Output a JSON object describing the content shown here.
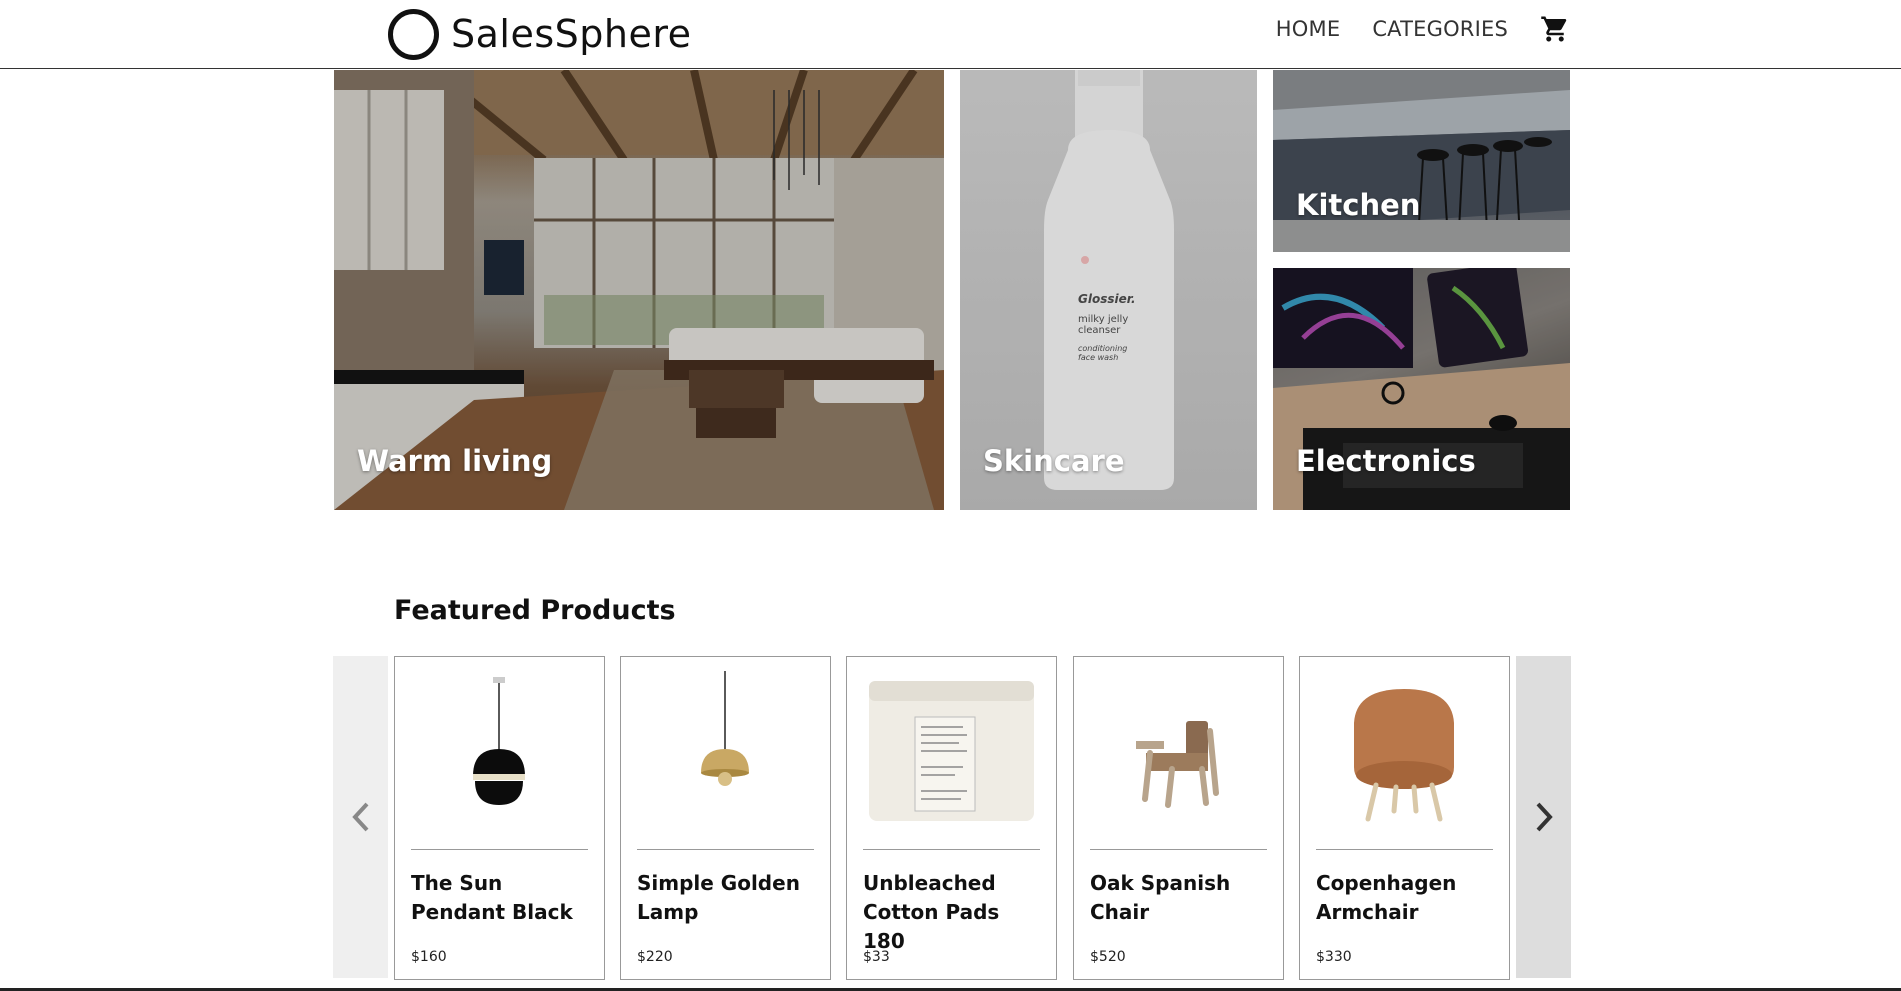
{
  "brand": {
    "name": "SalesSphere"
  },
  "nav": {
    "home": "HOME",
    "categories": "CATEGORIES",
    "cart_icon": "cart-icon"
  },
  "hero": {
    "tiles": [
      {
        "label": "Warm living"
      },
      {
        "label": "Skincare"
      },
      {
        "label": "Kitchen"
      },
      {
        "label": "Electronics"
      }
    ],
    "skincare_bottle": {
      "brand": "Glossier.",
      "line1": "milky jelly",
      "line2": "cleanser",
      "line3": "conditioning",
      "line4": "face wash"
    }
  },
  "featured": {
    "title": "Featured Products",
    "prev_icon": "chevron-left-icon",
    "next_icon": "chevron-right-icon",
    "products": [
      {
        "name": "The Sun Pendant Black",
        "price": "$160"
      },
      {
        "name": "Simple Golden Lamp",
        "price": "$220"
      },
      {
        "name": "Unbleached Cotton Pads 180",
        "price": "$33"
      },
      {
        "name": "Oak Spanish Chair",
        "price": "$520"
      },
      {
        "name": "Copenhagen Armchair",
        "price": "$330"
      }
    ]
  }
}
